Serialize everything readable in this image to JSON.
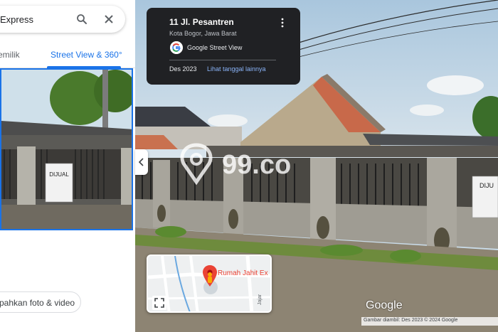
{
  "search": {
    "query": "Express"
  },
  "tabs": {
    "owner_label": "emilik",
    "street_view_label": "Street View & 360°"
  },
  "actions": {
    "add_photo_label": "pahkan foto & video"
  },
  "info_card": {
    "title": "11 Jl. Pesantren",
    "subtitle": "Kota Bogor, Jawa Barat",
    "provider": "Google Street View",
    "date": "Des 2023",
    "date_link": "Lihat tanggal lainnya"
  },
  "watermark": {
    "text": "99.co"
  },
  "sign_text": "DIJUAL",
  "sign_text_right": "DIJU",
  "minimap": {
    "place_label": "Rumah Jahit Ex",
    "road_label": "Jajar"
  },
  "brand": {
    "google_logo": "Google"
  },
  "attribution": {
    "text": "Gambar diambil: Des 2023  © 2024 Google"
  },
  "icons": {
    "search": "search-icon",
    "close": "close-icon",
    "more": "more-vert-icon",
    "collapse": "chevron-left-icon",
    "expand": "fullscreen-icon",
    "pin": "map-pin-icon",
    "pegman": "pegman-icon"
  },
  "colors": {
    "accent": "#1a73e8",
    "card_bg": "#202124",
    "link": "#8ab4f8",
    "pin": "#ea4335"
  }
}
